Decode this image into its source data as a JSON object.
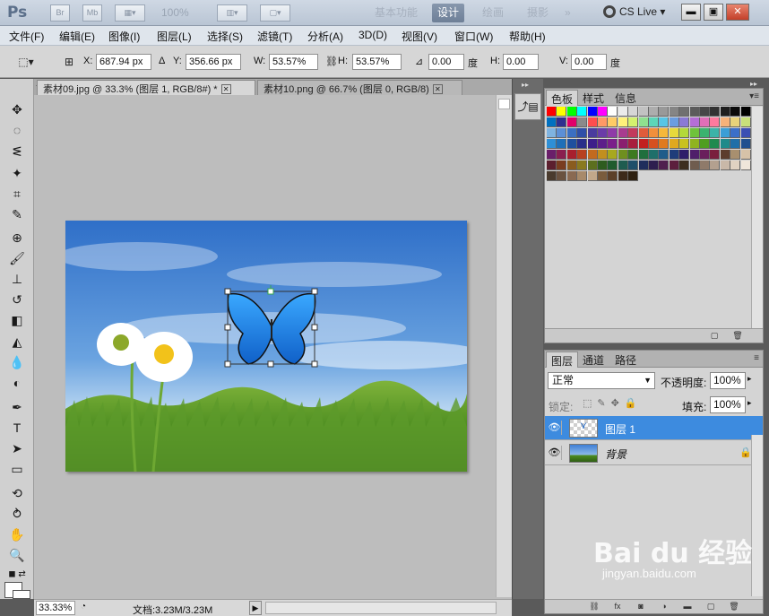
{
  "app": {
    "logo": "Ps",
    "bridge_btn": "Br",
    "minibridge_btn": "Mb",
    "zoom": "100%",
    "workspaces": [
      "基本功能",
      "设计",
      "绘画",
      "摄影"
    ],
    "active_workspace": "设计",
    "more": "»",
    "cs_live": "CS Live"
  },
  "menu": [
    "文件(F)",
    "编辑(E)",
    "图像(I)",
    "图层(L)",
    "选择(S)",
    "滤镜(T)",
    "分析(A)",
    "3D(D)",
    "视图(V)",
    "窗口(W)",
    "帮助(H)"
  ],
  "options": {
    "x_label": "X:",
    "x_value": "687.94 px",
    "y_label": "Y:",
    "y_value": "356.66 px",
    "w_label": "W:",
    "w_value": "53.57%",
    "h_label": "H:",
    "h_value": "53.57%",
    "angle_value": "0.00",
    "angle_unit": "度",
    "hskew_label": "H:",
    "hskew_value": "0.00",
    "vskew_label": "V:",
    "vskew_value": "0.00",
    "skew_unit": "度"
  },
  "tabs": [
    {
      "label": "素材09.jpg @ 33.3% (图层 1, RGB/8#) *",
      "active": true
    },
    {
      "label": "素材10.png @ 66.7% (图层 0, RGB/8)",
      "active": false
    }
  ],
  "status": {
    "zoom": "33.33%",
    "doc": "文档:3.23M/3.23M"
  },
  "swatches_panel": {
    "tabs": [
      "色板",
      "样式",
      "信息"
    ],
    "colors": [
      "#ff0000",
      "#ffff00",
      "#00ff00",
      "#00ffff",
      "#0000ff",
      "#ff00ff",
      "#ffffff",
      "#ebebeb",
      "#d6d6d6",
      "#c2c2c2",
      "#adadad",
      "#999999",
      "#858585",
      "#707070",
      "#5c5c5c",
      "#474747",
      "#333333",
      "#1f1f1f",
      "#0a0a0a",
      "#000000",
      "#0070c0",
      "#2f2f8f",
      "#e0006a",
      "#8a8a8a",
      "#ff4d4d",
      "#ff9966",
      "#ffcc66",
      "#fff27a",
      "#d4f26e",
      "#8fe08f",
      "#5cd6b8",
      "#57c5e6",
      "#6a9de0",
      "#8a7ad6",
      "#b56ed6",
      "#e06eb8",
      "#ff7a9e",
      "#f7b27a",
      "#e8d27a",
      "#c9e07a",
      "#7fb3e0",
      "#5c8fd6",
      "#3b6fc2",
      "#2f4fa8",
      "#4a3b9e",
      "#6a3ba8",
      "#8f3ba8",
      "#a83b8f",
      "#c23b5c",
      "#e05c3b",
      "#f08f3b",
      "#f5b83b",
      "#e6d93b",
      "#b3d93b",
      "#6fc23b",
      "#3bb36f",
      "#3bb3a8",
      "#3b9ed6",
      "#3b6fc9",
      "#3b4fb3",
      "#2e8fd6",
      "#1f6fb8",
      "#1f4f9e",
      "#2a2f8a",
      "#3d1f8a",
      "#5c1f8a",
      "#7a1f8a",
      "#8a1f6f",
      "#a81f3d",
      "#c21f1f",
      "#d6501f",
      "#e07a1f",
      "#e0a81f",
      "#c9c21f",
      "#8fb31f",
      "#4f9e1f",
      "#1f8a4f",
      "#1f8a8a",
      "#1f6fa8",
      "#1f4f8f",
      "#6a1f6a",
      "#8a1f4f",
      "#a81f2e",
      "#b8401f",
      "#c26a1f",
      "#c28f1f",
      "#a8a81f",
      "#6f8f1f",
      "#3d7a1f",
      "#1f6f3d",
      "#1f6f6a",
      "#1f5c8a",
      "#1f3d7a",
      "#2e1f6a",
      "#4f1f6a",
      "#6a1f5c",
      "#7a1f3d",
      "#5c3d2e",
      "#a88f6f",
      "#d6c2a8",
      "#5c1f2e",
      "#7a3d1f",
      "#8a5c1f",
      "#8a7a1f",
      "#5c6f1f",
      "#2e5c1f",
      "#1f5c2e",
      "#1f5c4f",
      "#1f4f6a",
      "#1f2e5c",
      "#2e1f4f",
      "#4f1f4f",
      "#5c1f3d",
      "#3d2e1f",
      "#6f5c4f",
      "#8f7a6a",
      "#b3a08f",
      "#c9b8a8",
      "#e0d2c2",
      "#f0e6da",
      "#4a3b2e",
      "#6a5240",
      "#8a6a52",
      "#a88a6a",
      "#c2a88a",
      "#7a5c3d",
      "#5c4029",
      "#3d2a1a",
      "#2e2010"
    ]
  },
  "layers_panel": {
    "tabs": [
      "图层",
      "通道",
      "路径"
    ],
    "blend_mode": "正常",
    "opacity_label": "不透明度:",
    "opacity_value": "100%",
    "lock_label": "锁定:",
    "fill_label": "填充:",
    "fill_value": "100%",
    "layers": [
      {
        "name": "图层 1",
        "selected": true
      },
      {
        "name": "背景",
        "selected": false
      }
    ]
  },
  "watermark": {
    "brand": "Bai du 经验",
    "url": "jingyan.baidu.com"
  }
}
